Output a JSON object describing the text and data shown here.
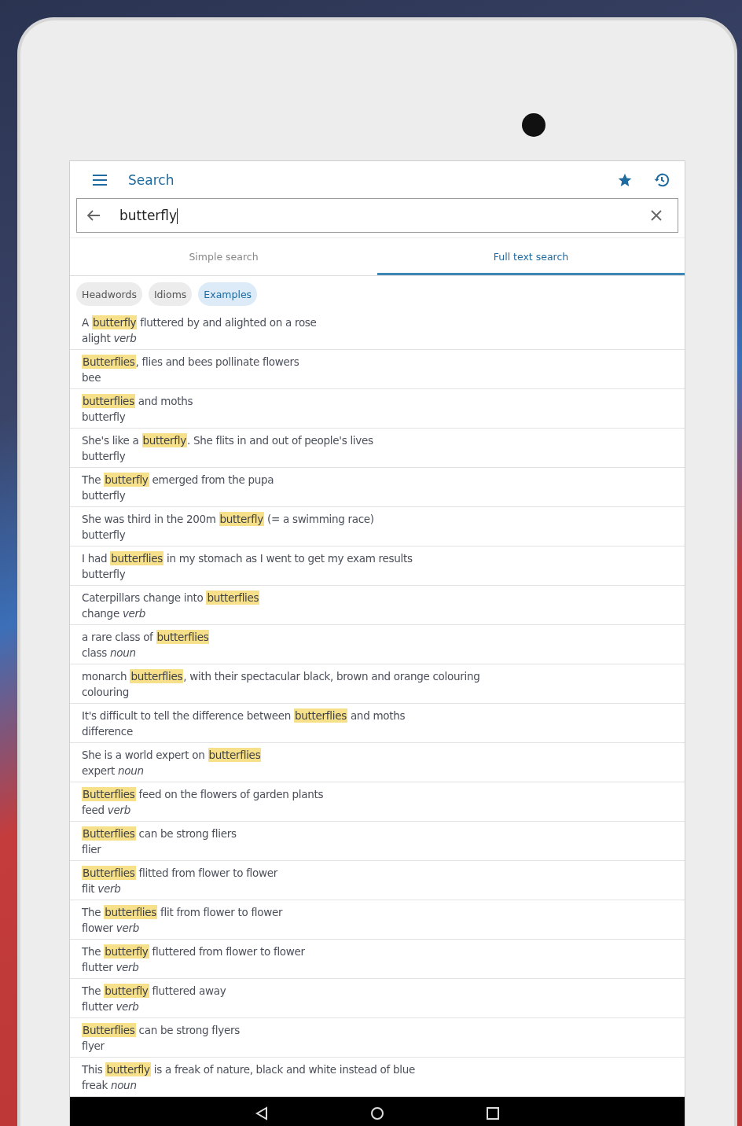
{
  "app_bar": {
    "title": "Search"
  },
  "search": {
    "value": "butterfly"
  },
  "tabs": [
    {
      "label": "Simple search",
      "selected": false
    },
    {
      "label": "Full text search",
      "selected": true
    }
  ],
  "filters": [
    {
      "label": "Headwords",
      "selected": false
    },
    {
      "label": "Idioms",
      "selected": false
    },
    {
      "label": "Examples",
      "selected": true
    }
  ],
  "results": [
    {
      "example": "A **butterfly** fluttered by and alighted on a rose",
      "headword": "alight *verb*"
    },
    {
      "example": "**Butterflies**, flies and bees pollinate flowers",
      "headword": "bee"
    },
    {
      "example": "**butterflies** and moths",
      "headword": "butterfly"
    },
    {
      "example": "She's like a **butterfly**. She flits in and out of people's lives",
      "headword": "butterfly"
    },
    {
      "example": "The **butterfly** emerged from the pupa",
      "headword": "butterfly"
    },
    {
      "example": "She was third in the 200m **butterfly** (= a swimming race)",
      "headword": "butterfly"
    },
    {
      "example": "I had **butterflies** in my stomach as I went to get my exam results",
      "headword": "butterfly"
    },
    {
      "example": "Caterpillars change into **butterflies**",
      "headword": "change *verb*"
    },
    {
      "example": "a rare class of **butterflies**",
      "headword": "class *noun*"
    },
    {
      "example": "monarch **butterflies**, with their spectacular black, brown and orange colouring",
      "headword": "colouring"
    },
    {
      "example": "It's difficult to tell the difference between **butterflies** and moths",
      "headword": "difference"
    },
    {
      "example": "She is a world expert on **butterflies**",
      "headword": "expert *noun*"
    },
    {
      "example": "**Butterflies** feed on the flowers of garden plants",
      "headword": "feed *verb*"
    },
    {
      "example": "**Butterflies** can be strong fliers",
      "headword": "flier"
    },
    {
      "example": "**Butterflies** flitted from flower to flower",
      "headword": "flit *verb*"
    },
    {
      "example": "The **butterflies** flit from flower to flower",
      "headword": "flower *verb*"
    },
    {
      "example": "The **butterfly** fluttered from flower to flower",
      "headword": "flutter *verb*"
    },
    {
      "example": "The **butterfly** fluttered away",
      "headword": "flutter *verb*"
    },
    {
      "example": "**Butterflies** can be strong flyers",
      "headword": "flyer"
    },
    {
      "example": "This **butterfly** is a freak of nature, black and white instead of blue",
      "headword": "freak *noun*"
    }
  ]
}
